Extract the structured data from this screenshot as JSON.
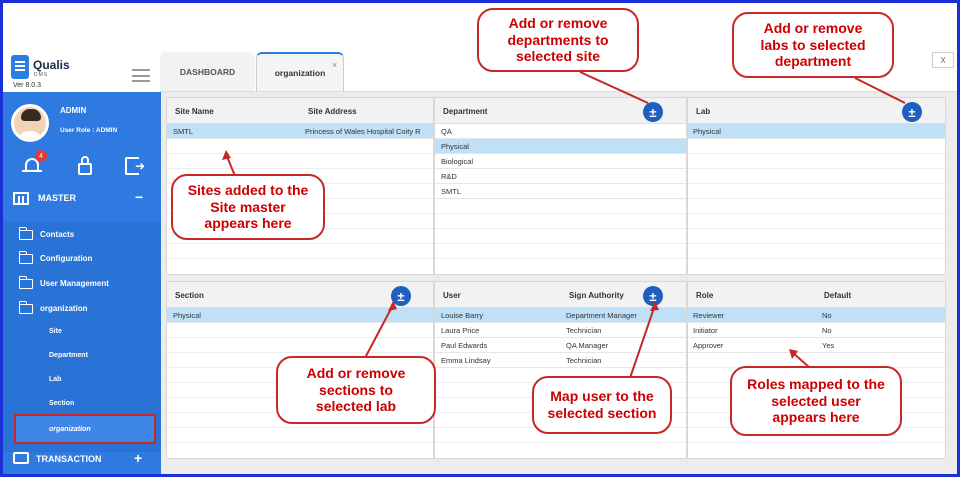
{
  "app": {
    "brand_name": "Qualis",
    "brand_sub": "DMS",
    "version": "Ver 8.0.3"
  },
  "tabs": [
    {
      "label": "DASHBOARD"
    },
    {
      "label": "organization"
    }
  ],
  "tab_close": "×",
  "window_close": "X",
  "user": {
    "name": "ADMIN",
    "role": "User Role : ADMIN",
    "notification_count": "4"
  },
  "sidebar": {
    "master_label": "MASTER",
    "master_toggle": "−",
    "items": [
      {
        "label": "Contacts"
      },
      {
        "label": "Configuration"
      },
      {
        "label": "User Management"
      },
      {
        "label": "organization"
      }
    ],
    "sub_items": [
      {
        "label": "Site"
      },
      {
        "label": "Department"
      },
      {
        "label": "Lab"
      },
      {
        "label": "Section"
      },
      {
        "label": "organization"
      }
    ],
    "transaction_label": "TRANSACTION",
    "transaction_toggle": "+"
  },
  "panels": {
    "site": {
      "headers": [
        "Site Name",
        "Site Address"
      ],
      "rows": [
        {
          "name": "SMTL",
          "address": "Princess of Wales Hospital Coity R"
        }
      ]
    },
    "department": {
      "header": "Department",
      "rows": [
        "QA",
        "Physical",
        "Biological",
        "R&D",
        "SMTL"
      ]
    },
    "lab": {
      "header": "Lab",
      "rows": [
        "Physical"
      ]
    },
    "section": {
      "header": "Section",
      "rows": [
        "Physical"
      ]
    },
    "user": {
      "headers": [
        "User",
        "Sign Authority"
      ],
      "rows": [
        {
          "user": "Louise Barry",
          "authority": "Department Manager"
        },
        {
          "user": "Laura Price",
          "authority": "Technician"
        },
        {
          "user": "Paul Edwards",
          "authority": "QA Manager"
        },
        {
          "user": "Emma Lindsay",
          "authority": "Technician"
        }
      ]
    },
    "role": {
      "headers": [
        "Role",
        "Default"
      ],
      "rows": [
        {
          "role": "Reviewer",
          "default": "No"
        },
        {
          "role": "Initiator",
          "default": "No"
        },
        {
          "role": "Approver",
          "default": "Yes"
        }
      ]
    }
  },
  "add_button_symbol": "±",
  "callouts": {
    "departments": [
      "Add or remove",
      "departments to",
      "selected site"
    ],
    "labs": [
      "Add or remove",
      "labs to selected",
      "department"
    ],
    "sites": [
      "Sites added to the",
      "Site master",
      "appears here"
    ],
    "sections": [
      "Add or remove",
      "sections to",
      "selected lab"
    ],
    "map_user": [
      "Map user to the",
      "selected section"
    ],
    "roles": [
      "Roles mapped to the",
      "selected user",
      "appears here"
    ]
  },
  "colors": {
    "sidebar": "#2f7ae0",
    "frame": "#1a2fd6",
    "callout_red": "#c62828",
    "selected_row": "#bfe0f7",
    "add_button": "#1f5fbf"
  }
}
